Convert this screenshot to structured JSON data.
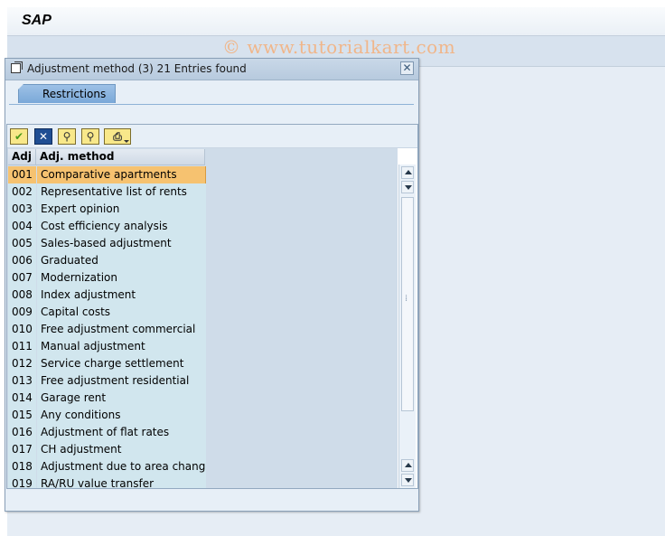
{
  "app": {
    "title": "SAP",
    "watermark": "© www.tutorialkart.com"
  },
  "dialog": {
    "title": "Adjustment method (3)   21 Entries found",
    "close_glyph": "✕",
    "tabs": [
      {
        "label": "Restrictions"
      }
    ]
  },
  "toolbar": {
    "buttons": [
      {
        "name": "ok",
        "icon": "checkmark-icon",
        "glyph": "✔"
      },
      {
        "name": "cancel",
        "icon": "cancel-icon",
        "glyph": "✕"
      },
      {
        "name": "find",
        "icon": "binoculars-icon",
        "glyph": "⚲"
      },
      {
        "name": "find-next",
        "icon": "binoculars-plus-icon",
        "glyph": "⚲"
      },
      {
        "name": "print",
        "icon": "printer-icon",
        "glyph": "⎙"
      }
    ]
  },
  "table": {
    "columns": [
      "Adj",
      "Adj. method"
    ],
    "rows": [
      [
        "001",
        "Comparative apartments"
      ],
      [
        "002",
        "Representative list of rents"
      ],
      [
        "003",
        "Expert opinion"
      ],
      [
        "004",
        "Cost efficiency analysis"
      ],
      [
        "005",
        "Sales-based adjustment"
      ],
      [
        "006",
        "Graduated"
      ],
      [
        "007",
        "Modernization"
      ],
      [
        "008",
        "Index adjustment"
      ],
      [
        "009",
        "Capital costs"
      ],
      [
        "010",
        "Free adjustment commercial"
      ],
      [
        "011",
        "Manual adjustment"
      ],
      [
        "012",
        "Service charge settlement"
      ],
      [
        "013",
        "Free adjustment residential"
      ],
      [
        "014",
        "Garage rent"
      ],
      [
        "015",
        "Any conditions"
      ],
      [
        "016",
        "Adjustment of flat rates"
      ],
      [
        "017",
        "CH adjustment"
      ],
      [
        "018",
        "Adjustment due to area change"
      ],
      [
        "019",
        "RA/RU value transfer"
      ]
    ],
    "selected_row": 0
  },
  "colors": {
    "selection": "#f6c270",
    "row_bg": "#d1e6ee",
    "tab": "#7aa8d8"
  }
}
